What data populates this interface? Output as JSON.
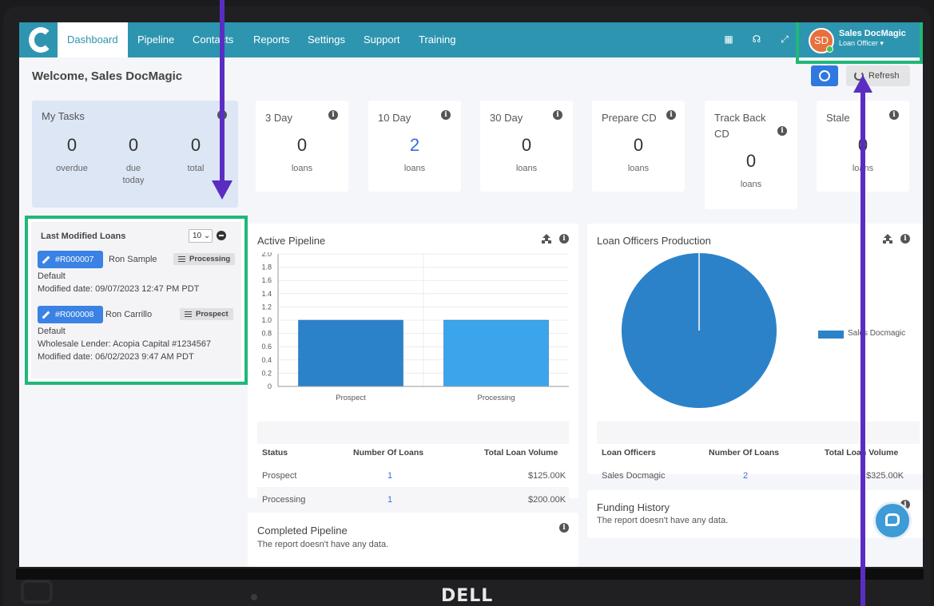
{
  "nav": {
    "items": [
      "Dashboard",
      "Pipeline",
      "Contacts",
      "Reports",
      "Settings",
      "Support",
      "Training"
    ],
    "icons": [
      "calendar-icon",
      "headset-icon",
      "expand-icon"
    ]
  },
  "user": {
    "initials": "SD",
    "name": "Sales DocMagic",
    "role": "Loan Officer ▾"
  },
  "welcome": "Welcome, Sales DocMagic",
  "refresh_label": "Refresh",
  "tasks": {
    "title": "My Tasks",
    "overdue": "0",
    "overdue_label": "overdue",
    "due_today": "0",
    "due_today_label": "due today",
    "total": "0",
    "total_label": "total"
  },
  "stats": [
    {
      "title": "3 Day",
      "value": "0",
      "unit": "loans"
    },
    {
      "title": "10 Day",
      "value": "2",
      "unit": "loans"
    },
    {
      "title": "30 Day",
      "value": "0",
      "unit": "loans"
    },
    {
      "title": "Prepare CD",
      "value": "0",
      "unit": "loans"
    },
    {
      "title": "Track Back CD",
      "value": "0",
      "unit": "loans"
    },
    {
      "title": "Stale",
      "value": "0",
      "unit": "loans"
    }
  ],
  "last_modified": {
    "title": "Last Modified Loans",
    "page_size": "10",
    "loans": [
      {
        "id": "#R000007",
        "borrower": "Ron Sample",
        "status": "Processing",
        "line1": "Default",
        "line2": "Modified date: 09/07/2023 12:47 PM PDT",
        "line3": ""
      },
      {
        "id": "#R000008",
        "borrower": "Ron Carrillo",
        "status": "Prospect",
        "line1": "Default",
        "line2": "Wholesale Lender: Acopia Capital #1234567",
        "line3": "Modified date: 06/02/2023 9:47 AM PDT"
      }
    ]
  },
  "active_pipeline": {
    "title": "Active Pipeline",
    "table_headers": [
      "Status",
      "Number Of Loans",
      "Total Loan Volume"
    ],
    "rows": [
      {
        "status": "Prospect",
        "count": "1",
        "volume": "$125.00K"
      },
      {
        "status": "Processing",
        "count": "1",
        "volume": "$200.00K"
      }
    ]
  },
  "lo_production": {
    "title": "Loan Officers Production",
    "table_headers": [
      "Loan Officers",
      "Number Of Loans",
      "Total Loan Volume"
    ],
    "rows": [
      {
        "officer": "Sales Docmagic",
        "count": "2",
        "volume": "$325.00K"
      }
    ]
  },
  "funding_history": {
    "title": "Funding History",
    "empty": "The report doesn't have any data."
  },
  "completed_pipeline": {
    "title": "Completed Pipeline",
    "empty": "The report doesn't have any data."
  },
  "brand": "DELL",
  "colors": {
    "nav": "#2e95b0",
    "bar_prospect": "#2c82c9",
    "bar_processing": "#3aa5ea",
    "highlight": "#1fb878",
    "arrow": "#5a2dc2"
  },
  "chart_data": [
    {
      "type": "bar",
      "categories": [
        "Prospect",
        "Processing"
      ],
      "values": [
        1,
        1
      ],
      "ylim": [
        0,
        2.0
      ],
      "yticks": [
        "2.0",
        "1.8",
        "1.6",
        "1.4",
        "1.2",
        "1.0",
        "0.8",
        "0.6",
        "0.4",
        "0.2",
        "0"
      ],
      "colors": [
        "#2c82c9",
        "#3aa5ea"
      ],
      "title": "",
      "xlabel": "",
      "ylabel": ""
    },
    {
      "type": "pie",
      "labels": [
        "Sales Docmagic"
      ],
      "values": [
        2
      ],
      "colors": [
        "#2c82c9"
      ],
      "legend": "right"
    }
  ]
}
